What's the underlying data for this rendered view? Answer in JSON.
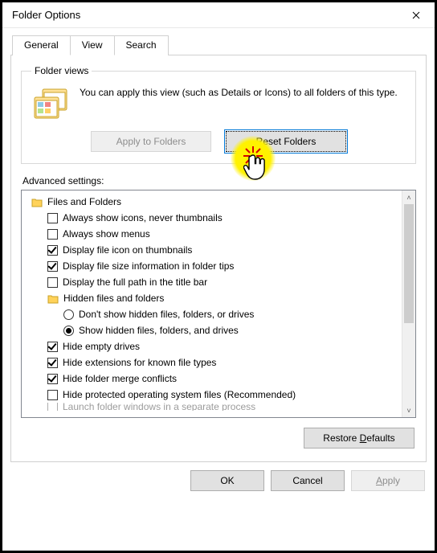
{
  "window": {
    "title": "Folder Options"
  },
  "tabs": {
    "general": "General",
    "view": "View",
    "search": "Search"
  },
  "folderViews": {
    "legend": "Folder views",
    "desc": "You can apply this view (such as Details or Icons) to all folders of this type.",
    "applyBtn": "Apply to Folders",
    "resetBtn_pre": "",
    "resetBtn_u": "R",
    "resetBtn_post": "eset Folders"
  },
  "advanced": {
    "label": "Advanced settings:",
    "header": "Files and Folders",
    "items": [
      {
        "type": "check",
        "checked": false,
        "label": "Always show icons, never thumbnails"
      },
      {
        "type": "check",
        "checked": false,
        "label": "Always show menus"
      },
      {
        "type": "check",
        "checked": true,
        "label": "Display file icon on thumbnails"
      },
      {
        "type": "check",
        "checked": true,
        "label": "Display file size information in folder tips"
      },
      {
        "type": "check",
        "checked": false,
        "label": "Display the full path in the title bar"
      }
    ],
    "hidden": {
      "header": "Hidden files and folders",
      "opt1": "Don't show hidden files, folders, or drives",
      "opt2": "Show hidden files, folders, and drives"
    },
    "items2": [
      {
        "type": "check",
        "checked": true,
        "label": "Hide empty drives"
      },
      {
        "type": "check",
        "checked": true,
        "label": "Hide extensions for known file types"
      },
      {
        "type": "check",
        "checked": true,
        "label": "Hide folder merge conflicts"
      },
      {
        "type": "check",
        "checked": false,
        "label": "Hide protected operating system files (Recommended)"
      }
    ],
    "cutoff": "Launch folder windows in a separate process"
  },
  "restore_pre": "Restore ",
  "restore_u": "D",
  "restore_post": "efaults",
  "footer": {
    "ok": "OK",
    "cancel": "Cancel",
    "apply_u": "A",
    "apply_post": "pply"
  }
}
